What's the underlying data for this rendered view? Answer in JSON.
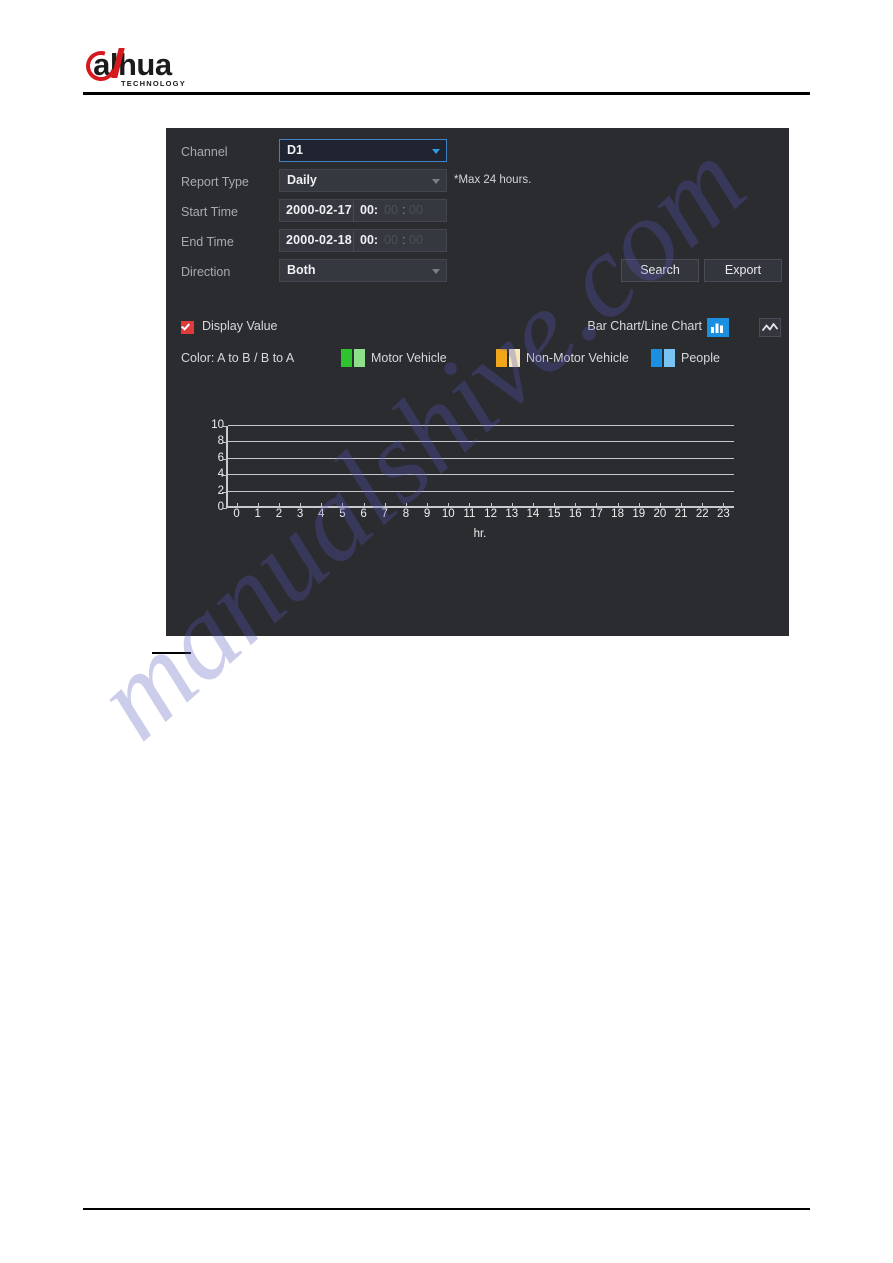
{
  "brand": {
    "name": "alhua",
    "tagline": "TECHNOLOGY"
  },
  "watermark": {
    "text": "manualshive.com"
  },
  "dialog": {
    "fields": {
      "channel": {
        "label": "Channel",
        "value": "D1",
        "caret_icon": "chevron-down-icon"
      },
      "report_type": {
        "label": "Report Type",
        "value": "Daily",
        "hint": "*Max 24 hours.",
        "caret_icon": "chevron-down-icon"
      },
      "start_time": {
        "label": "Start Time",
        "date": "2000-02-17",
        "hour": "00:",
        "minute": "00",
        "colon": ":",
        "second": "00"
      },
      "end_time": {
        "label": "End Time",
        "date": "2000-02-18",
        "hour": "00:",
        "minute": "00",
        "colon": ":",
        "second": "00"
      },
      "direction": {
        "label": "Direction",
        "value": "Both",
        "caret_icon": "chevron-down-icon"
      }
    },
    "buttons": {
      "search": "Search",
      "export": "Export"
    },
    "options": {
      "display_value": {
        "label": "Display Value",
        "checked": true,
        "check_color": "#e03a3a"
      },
      "chart_toggle": {
        "label": "Bar Chart/Line Chart",
        "bar_icon": "bar-chart-icon",
        "line_icon": "line-chart-icon",
        "active": "bar"
      }
    },
    "legend": {
      "title": "Color: A to B / B to A",
      "items": [
        {
          "label": "Motor Vehicle",
          "color_a": "#2fc42f",
          "color_b": "#8fe08a"
        },
        {
          "label": "Non-Motor Vehicle",
          "color_a": "#f0a81a",
          "color_b": "#f7e9bd"
        },
        {
          "label": "People",
          "color_a": "#1b8fe0",
          "color_b": "#79c3f2"
        }
      ]
    }
  },
  "chart_data": {
    "type": "bar",
    "title": "",
    "xlabel": "hr.",
    "ylabel": "",
    "x": [
      0,
      1,
      2,
      3,
      4,
      5,
      6,
      7,
      8,
      9,
      10,
      11,
      12,
      13,
      14,
      15,
      16,
      17,
      18,
      19,
      20,
      21,
      22,
      23
    ],
    "categories": [
      "0",
      "1",
      "2",
      "3",
      "4",
      "5",
      "6",
      "7",
      "8",
      "9",
      "10",
      "11",
      "12",
      "13",
      "14",
      "15",
      "16",
      "17",
      "18",
      "19",
      "20",
      "21",
      "22",
      "23"
    ],
    "yticks": [
      0,
      2,
      4,
      6,
      8,
      10
    ],
    "ylim": [
      0,
      10
    ],
    "xlim": [
      0,
      23
    ],
    "grid": true,
    "legend_position": "top",
    "series": [
      {
        "name": "Motor Vehicle A to B",
        "values": [
          0,
          0,
          0,
          0,
          0,
          0,
          0,
          0,
          0,
          0,
          0,
          0,
          0,
          0,
          0,
          0,
          0,
          0,
          0,
          0,
          0,
          0,
          0,
          0
        ]
      },
      {
        "name": "Motor Vehicle B to A",
        "values": [
          0,
          0,
          0,
          0,
          0,
          0,
          0,
          0,
          0,
          0,
          0,
          0,
          0,
          0,
          0,
          0,
          0,
          0,
          0,
          0,
          0,
          0,
          0,
          0
        ]
      },
      {
        "name": "Non-Motor Vehicle A to B",
        "values": [
          0,
          0,
          0,
          0,
          0,
          0,
          0,
          0,
          0,
          0,
          0,
          0,
          0,
          0,
          0,
          0,
          0,
          0,
          0,
          0,
          0,
          0,
          0,
          0
        ]
      },
      {
        "name": "Non-Motor Vehicle B to A",
        "values": [
          0,
          0,
          0,
          0,
          0,
          0,
          0,
          0,
          0,
          0,
          0,
          0,
          0,
          0,
          0,
          0,
          0,
          0,
          0,
          0,
          0,
          0,
          0,
          0
        ]
      },
      {
        "name": "People A to B",
        "values": [
          0,
          0,
          0,
          0,
          0,
          0,
          0,
          0,
          0,
          0,
          0,
          0,
          0,
          0,
          0,
          0,
          0,
          0,
          0,
          0,
          0,
          0,
          0,
          0
        ]
      },
      {
        "name": "People B to A",
        "values": [
          0,
          0,
          0,
          0,
          0,
          0,
          0,
          0,
          0,
          0,
          0,
          0,
          0,
          0,
          0,
          0,
          0,
          0,
          0,
          0,
          0,
          0,
          0,
          0
        ]
      }
    ]
  }
}
